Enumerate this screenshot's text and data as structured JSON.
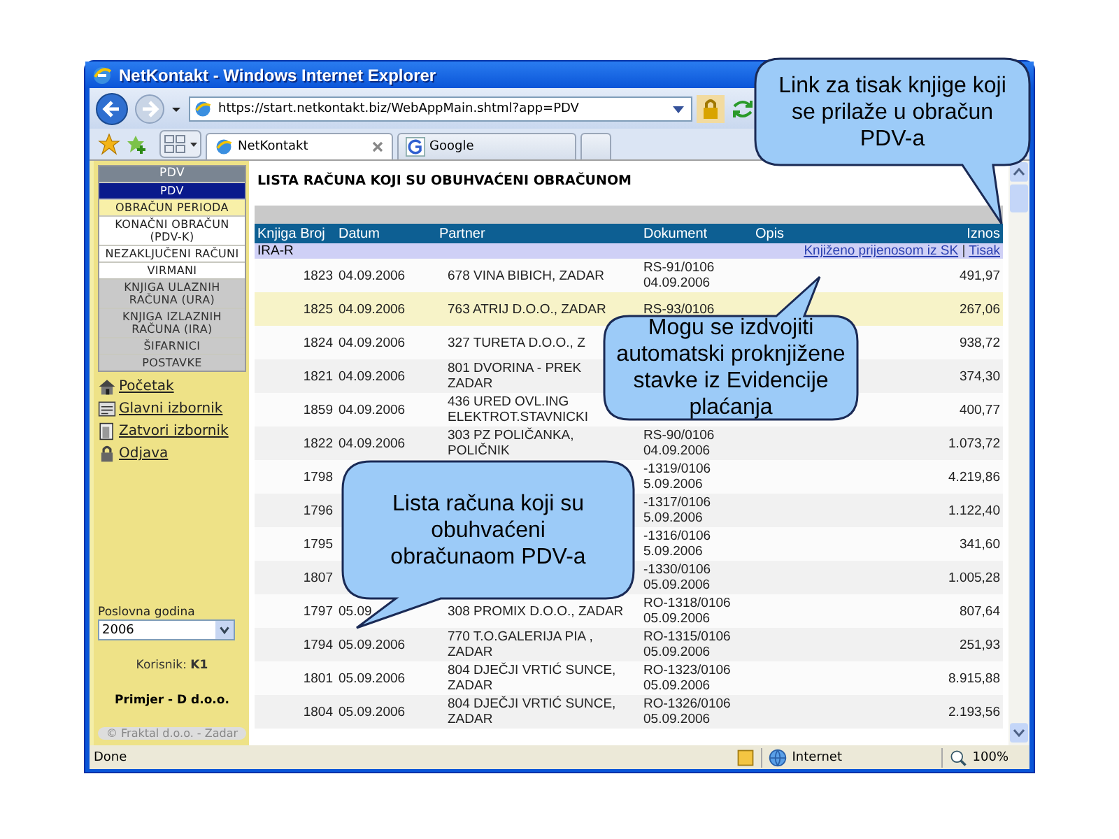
{
  "window": {
    "title": "NetKontakt - Windows Internet Explorer"
  },
  "address_bar": {
    "value": "https://start.netkontakt.biz/WebAppMain.shtml?app=PDV"
  },
  "tabs": [
    {
      "label": "NetKontakt",
      "selected": true
    },
    {
      "label": "Google",
      "selected": false
    }
  ],
  "sidebar": {
    "title": "PDV",
    "menu": [
      {
        "label": "PDV",
        "kind": "current"
      },
      {
        "label": "OBRAČUN PERIODA",
        "kind": "hover"
      },
      {
        "label": "KONAČNI OBRAČUN (PDV-K)",
        "kind": "item"
      },
      {
        "label": "NEZAKLJUČENI RAČUNI",
        "kind": "item"
      },
      {
        "label": "VIRMANI",
        "kind": "item"
      },
      {
        "label": "KNJIGA ULAZNIH RAČUNA (URA)",
        "kind": "group"
      },
      {
        "label": "KNJIGA IZLAZNIH RAČUNA (IRA)",
        "kind": "group"
      },
      {
        "label": "ŠIFARNICI",
        "kind": "group"
      },
      {
        "label": "POSTAVKE",
        "kind": "group"
      }
    ],
    "links": [
      "Početak",
      "Glavni izbornik",
      "Zatvori izbornik",
      "Odjava"
    ],
    "year_select": {
      "label": "Poslovna godina",
      "value": "2006"
    },
    "user": "Korisnik: **K1**",
    "company": "Primjer - D d.o.o.",
    "copyright": "© Fraktal d.o.o. - Zadar"
  },
  "report": {
    "title": "LISTA RAČUNA KOJI SU OBUHVAĆENI OBRAČUNOM",
    "columns": [
      "Knjiga Broj",
      "Datum",
      "Partner",
      "Dokument",
      "Opis",
      "Iznos"
    ],
    "group": {
      "label": "IRA-R",
      "links": [
        "Knjiženo prijenosom iz SK",
        "Tisak"
      ],
      "separator": "|"
    },
    "rows": [
      {
        "broj": "1823",
        "datum": "04.09.2006",
        "partner": [
          "678 VINA BIBICH, ZADAR"
        ],
        "dokument": [
          "RS-91/0106",
          "04.09.2006"
        ],
        "iznos": "491,97",
        "selected": false
      },
      {
        "broj": "1825",
        "datum": "04.09.2006",
        "partner": [
          "763 ATRIJ D.O.O., ZADAR"
        ],
        "dokument": [
          "RS-93/0106"
        ],
        "iznos": "267,06",
        "selected": true
      },
      {
        "broj": "1824",
        "datum": "04.09.2006",
        "partner": [
          "327 TURETA D.O.O., Z"
        ],
        "dokument": [],
        "iznos": "938,72",
        "selected": false
      },
      {
        "broj": "1821",
        "datum": "04.09.2006",
        "partner": [
          "801 DVORINA - PREK",
          "ZADAR"
        ],
        "dokument": [],
        "iznos": "374,30",
        "selected": false
      },
      {
        "broj": "1859",
        "datum": "04.09.2006",
        "partner": [
          "436 URED OVL.ING",
          "ELEKTROT.STAVNICKI"
        ],
        "dokument": [],
        "iznos": "400,77",
        "selected": false
      },
      {
        "broj": "1822",
        "datum": "04.09.2006",
        "partner": [
          "303 PZ POLIČANKA,",
          "POLIČNIK"
        ],
        "dokument": [
          "RS-90/0106",
          "04.09.2006"
        ],
        "iznos": "1.073,72",
        "selected": false
      },
      {
        "broj": "1798",
        "partner": [],
        "dokument": [
          "-1319/0106",
          "5.09.2006"
        ],
        "iznos": "4.219,86",
        "selected": false
      },
      {
        "broj": "1796",
        "partner": [],
        "dokument": [
          "-1317/0106",
          "5.09.2006"
        ],
        "iznos": "1.122,40",
        "selected": false
      },
      {
        "broj": "1795",
        "partner": [],
        "dokument": [
          "-1316/0106",
          "5.09.2006"
        ],
        "iznos": "341,60",
        "selected": false
      },
      {
        "broj": "1807",
        "partner": [],
        "dokument": [
          "-1330/0106",
          "05.09.2006"
        ],
        "iznos": "1.005,28",
        "selected": false
      },
      {
        "broj": "1797",
        "datum": "05.09",
        "partner": [
          "308 PROMIX D.O.O., ZADAR"
        ],
        "dokument": [
          "RO-1318/0106",
          "05.09.2006"
        ],
        "iznos": "807,64",
        "selected": false
      },
      {
        "broj": "1794",
        "datum": "05.09.2006",
        "partner": [
          "770 T.O.GALERIJA PIA ,",
          "ZADAR"
        ],
        "dokument": [
          "RO-1315/0106",
          "05.09.2006"
        ],
        "iznos": "251,93",
        "selected": false
      },
      {
        "broj": "1801",
        "datum": "05.09.2006",
        "partner": [
          "804 DJEČJI VRTIĆ SUNCE,",
          "ZADAR"
        ],
        "dokument": [
          "RO-1323/0106",
          "05.09.2006"
        ],
        "iznos": "8.915,88",
        "selected": false
      },
      {
        "broj": "1804",
        "datum": "05.09.2006",
        "partner": [
          "804 DJEČJI VRTIĆ SUNCE,",
          "ZADAR"
        ],
        "dokument": [
          "RO-1326/0106",
          "05.09.2006"
        ],
        "iznos": "2.193,56",
        "selected": false
      }
    ]
  },
  "callouts": [
    "Link za tisak knjige koji se prilaže u obračun PDV-a",
    "Mogu se izdvojiti automatski proknjižene stavke iz Evidencije plaćanja",
    "Lista računa koji su obuhvaćeni obračunaom PDV-a"
  ],
  "status_bar": {
    "text": "Done",
    "zone": "Internet",
    "zoom": "100%"
  }
}
